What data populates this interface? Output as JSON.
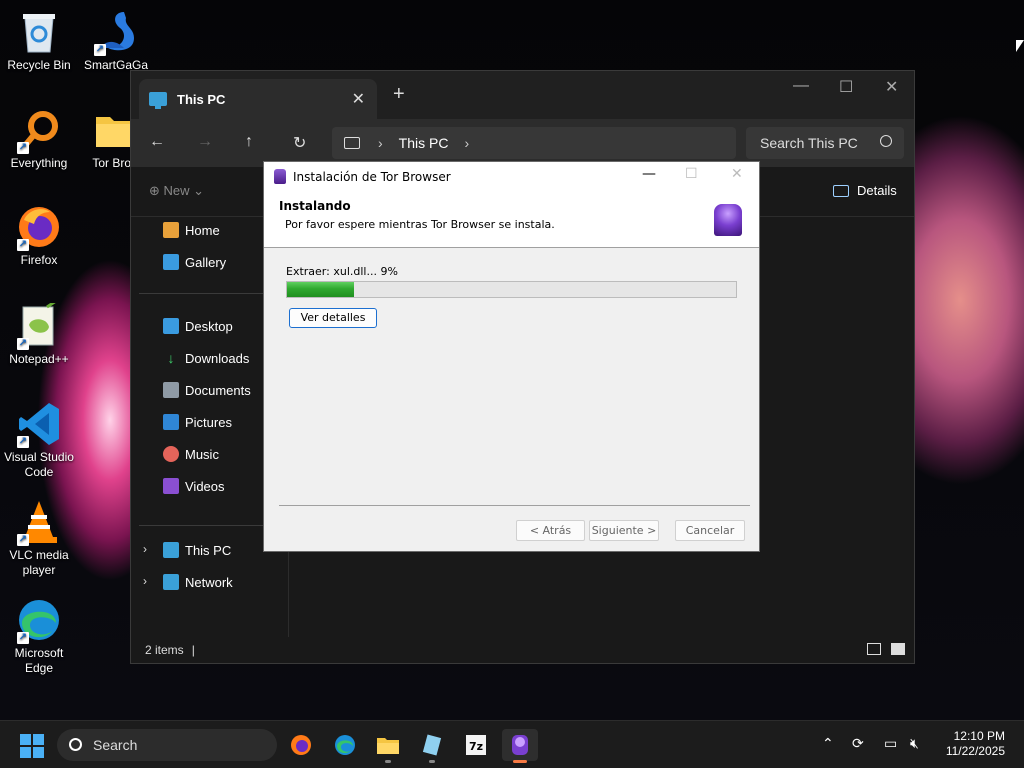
{
  "desktop": {
    "icons": [
      {
        "label": "Recycle Bin",
        "icon": "recycle-bin-icon"
      },
      {
        "label": "SmartGaGa",
        "icon": "smartgaga-icon"
      },
      {
        "label": "Everything",
        "icon": "everything-icon"
      },
      {
        "label": "Tor Brow",
        "icon": "folder-icon"
      },
      {
        "label": "Firefox",
        "icon": "firefox-icon"
      },
      {
        "label": "Notepad++",
        "icon": "notepadpp-icon"
      },
      {
        "label": "Visual Studio Code",
        "icon": "vscode-icon"
      },
      {
        "label": "VLC media player",
        "icon": "vlc-icon"
      },
      {
        "label": "Microsoft Edge",
        "icon": "edge-icon"
      }
    ]
  },
  "explorer": {
    "tab_title": "This PC",
    "new_tab": "+",
    "address_crumb": "This PC",
    "search_placeholder": "Search This PC",
    "cmd_new": "New",
    "cmd_details": "Details",
    "sidebar": {
      "items": [
        {
          "label": "Home"
        },
        {
          "label": "Gallery"
        },
        {
          "label": "Desktop"
        },
        {
          "label": "Downloads"
        },
        {
          "label": "Documents"
        },
        {
          "label": "Pictures"
        },
        {
          "label": "Music"
        },
        {
          "label": "Videos"
        },
        {
          "label": "This PC"
        },
        {
          "label": "Network"
        }
      ]
    },
    "status": "2 items"
  },
  "installer": {
    "title": "Instalación de Tor Browser",
    "header_title": "Instalando",
    "header_subtitle": "Por favor espere mientras Tor Browser se instala.",
    "progress_text": "Extraer: xul.dll... 9%",
    "progress_fraction": 0.15,
    "details_button": "Ver detalles",
    "back_button": "< Atrás",
    "next_button": "Siguiente >",
    "cancel_button": "Cancelar"
  },
  "taskbar": {
    "search_label": "Search",
    "apps": [
      "firefox-icon",
      "edge-icon",
      "file-explorer-icon",
      "notepad-icon",
      "7zip-icon",
      "tor-browser-icon"
    ],
    "time": "12:10 PM",
    "date": "11/22/2025"
  },
  "colors": {
    "accent": "#4ab0f5",
    "progress": "#2fa82f",
    "tor_purple": "#7a3fd0"
  }
}
